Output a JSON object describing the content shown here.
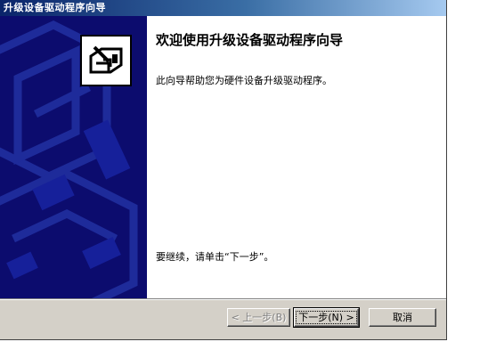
{
  "window": {
    "title": "升级设备驱动程序向导"
  },
  "content": {
    "heading": "欢迎使用升级设备驱动程序向导",
    "description": "此向导帮助您为硬件设备升级驱动程序。",
    "continue_text": "要继续，请单击“下一步”。"
  },
  "buttons": {
    "back": "< 上一步(B)",
    "next": "下一步(N) >",
    "cancel": "取消"
  },
  "icons": {
    "banner_icon": "hardware-card-icon"
  },
  "colors": {
    "title_bar": "#0a246a",
    "banner": "#0c0c6e",
    "dialog_face": "#d4d0c8"
  }
}
